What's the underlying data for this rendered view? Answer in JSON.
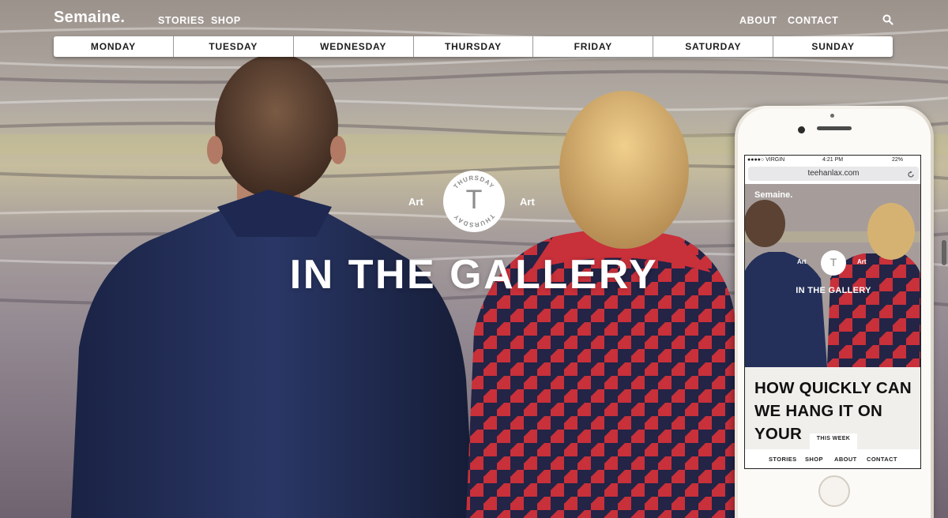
{
  "brand": {
    "logo": "Semaine."
  },
  "nav": {
    "left": [
      "STORIES",
      "SHOP"
    ],
    "right": [
      "ABOUT",
      "CONTACT"
    ],
    "search_icon": "search-icon"
  },
  "days": [
    "MONDAY",
    "TUESDAY",
    "WEDNESDAY",
    "THURSDAY",
    "FRIDAY",
    "SATURDAY",
    "SUNDAY"
  ],
  "hero": {
    "category_left": "Art",
    "category_right": "Art",
    "badge_letter": "T",
    "badge_ring_text": "THURSDAY",
    "title": "IN THE GALLERY"
  },
  "phone": {
    "status": {
      "carrier": "●●●●○ VIRGIN",
      "time": "4:21 PM",
      "battery": "22%"
    },
    "url": "teehanlax.com",
    "logo": "Semaine.",
    "category_left": "Art",
    "category_right": "Art",
    "badge_letter": "T",
    "title": "IN THE GALLERY",
    "headline": "HOW QUICKLY CAN WE HANG IT ON YOUR",
    "tab_label": "THIS WEEK",
    "nav": [
      "STORIES",
      "SHOP",
      "ABOUT",
      "CONTACT"
    ]
  },
  "colors": {
    "accent_red": "#c8303a",
    "jacket_navy": "#1f2a4d",
    "text_white": "#ffffff"
  }
}
